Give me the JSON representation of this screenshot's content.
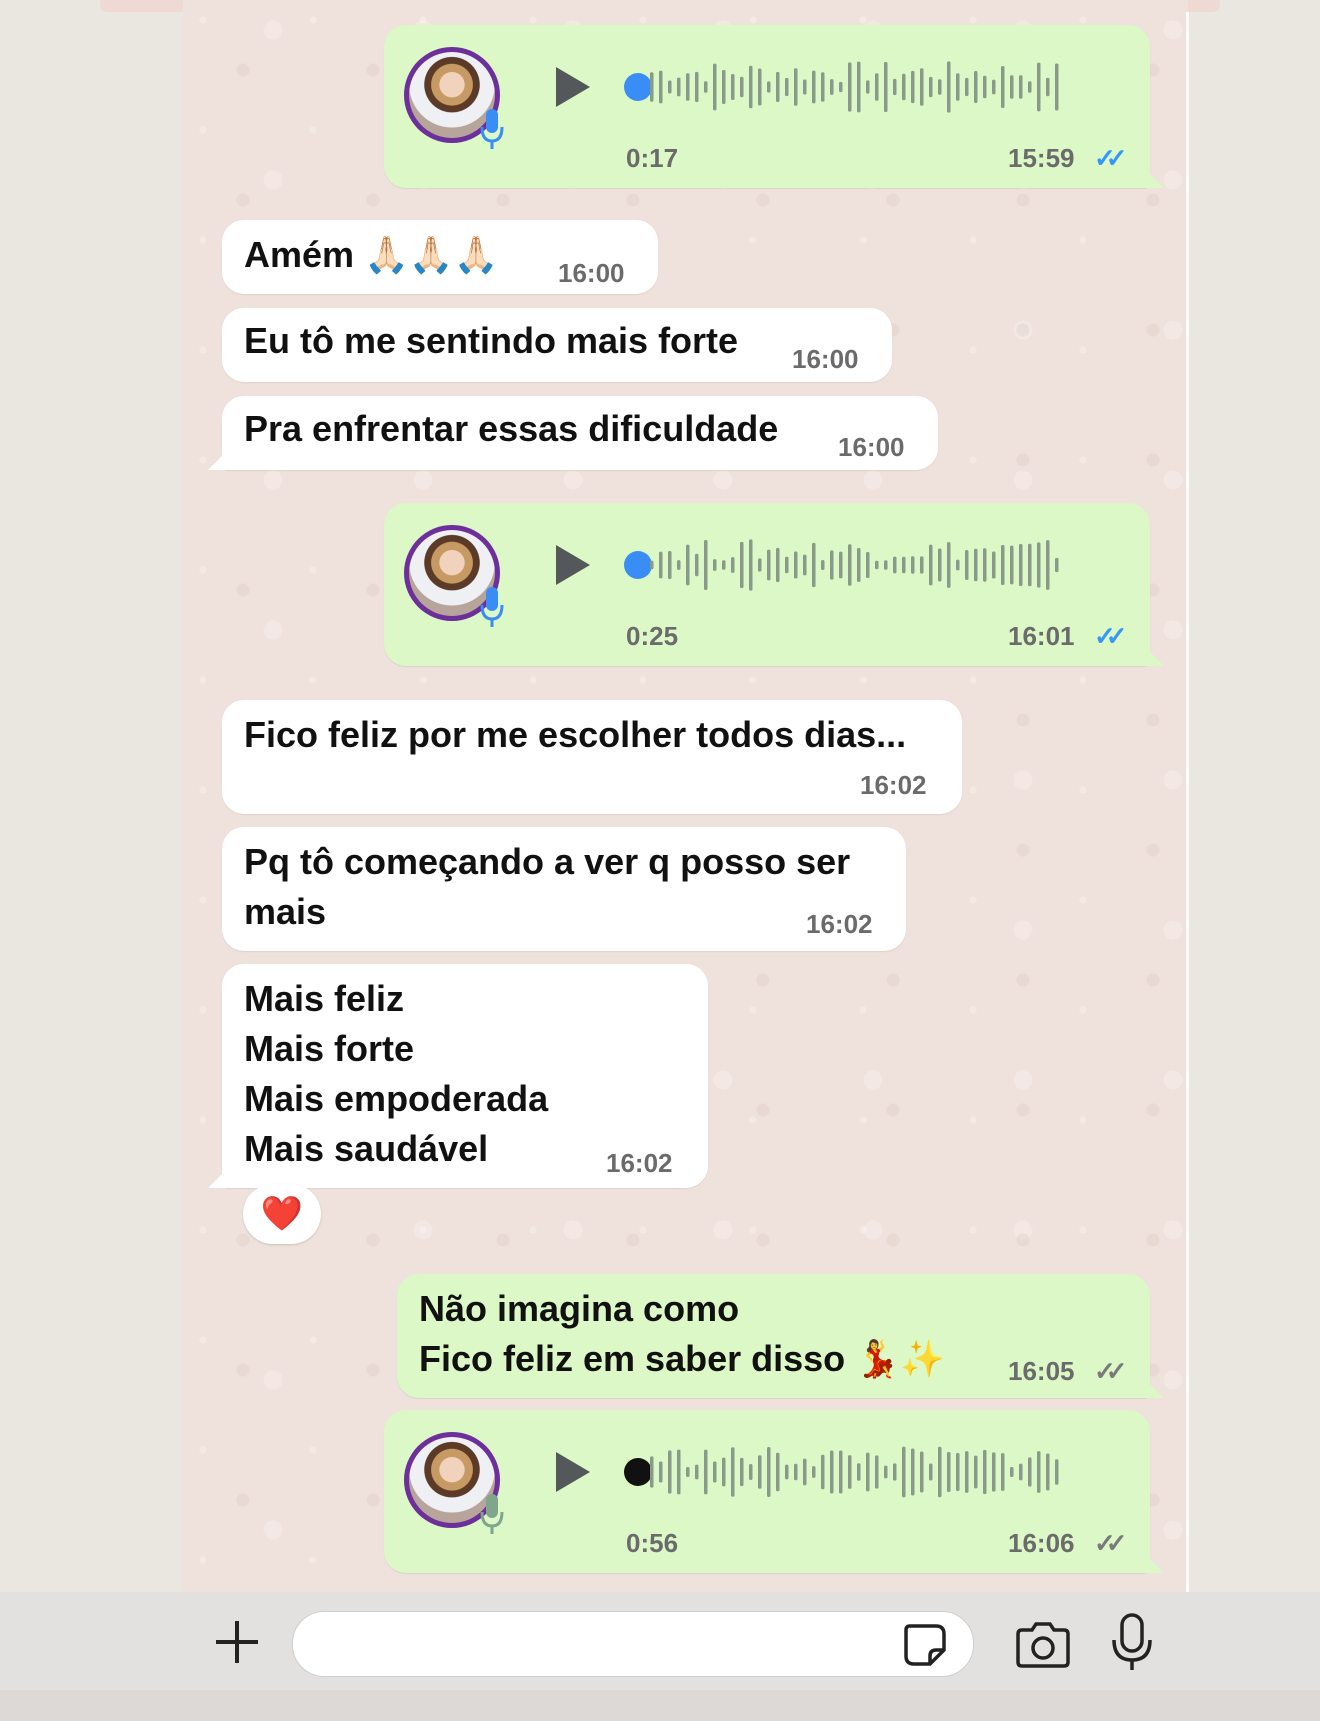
{
  "colors": {
    "incoming_bubble": "#ffffff",
    "outgoing_bubble": "#dbf8c6",
    "read_ticks": "#3497f9",
    "sent_ticks": "#7a7a7a",
    "chat_background": "#efe2dc"
  },
  "messages": [
    {
      "type": "voice",
      "direction": "out",
      "duration": "0:17",
      "time": "15:59",
      "status": "read"
    },
    {
      "type": "text",
      "direction": "in",
      "text": "Amém 🙏🏻🙏🏻🙏🏻",
      "time": "16:00"
    },
    {
      "type": "text",
      "direction": "in",
      "text": "Eu tô me sentindo mais forte",
      "time": "16:00"
    },
    {
      "type": "text",
      "direction": "in",
      "text": "Pra enfrentar essas dificuldade",
      "time": "16:00"
    },
    {
      "type": "voice",
      "direction": "out",
      "duration": "0:25",
      "time": "16:01",
      "status": "read"
    },
    {
      "type": "text",
      "direction": "in",
      "text": "Fico feliz por me escolher todos dias...",
      "time": "16:02"
    },
    {
      "type": "text",
      "direction": "in",
      "lines": [
        "Pq tô começando a ver q posso ser",
        "mais"
      ],
      "time": "16:02"
    },
    {
      "type": "text",
      "direction": "in",
      "lines": [
        "Mais feliz",
        "Mais forte",
        "Mais empoderada",
        "Mais saudável"
      ],
      "time": "16:02",
      "reaction": "❤️"
    },
    {
      "type": "text",
      "direction": "out",
      "lines": [
        "Não imagina como",
        "Fico feliz em saber disso 💃✨"
      ],
      "time": "16:05",
      "status": "sent"
    },
    {
      "type": "voice",
      "direction": "out",
      "duration": "0:56",
      "time": "16:06",
      "status": "sent"
    }
  ],
  "ticks_glyph": "✓✓",
  "input_bar": {
    "icons": [
      "plus-icon",
      "sticker-icon",
      "camera-icon",
      "microphone-icon"
    ]
  }
}
